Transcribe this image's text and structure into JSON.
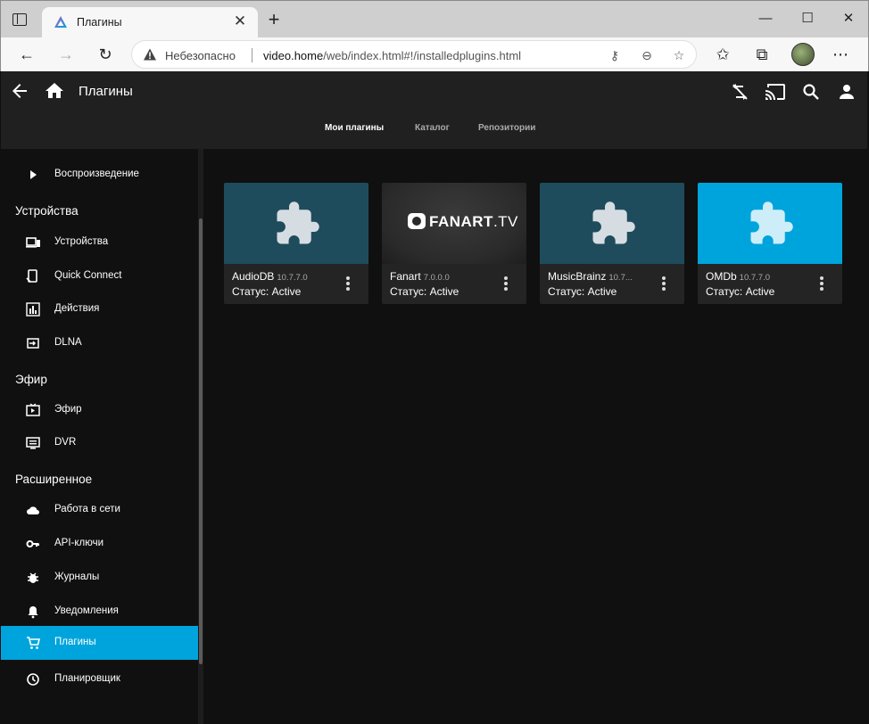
{
  "browser": {
    "tab_title": "Плагины",
    "insecure_label": "Небезопасно",
    "url_host": "video.home",
    "url_path": "/web/index.html#!/installedplugins.html"
  },
  "app": {
    "page_title": "Плагины",
    "tabs": [
      {
        "label": "Мои плагины",
        "active": true
      },
      {
        "label": "Каталог",
        "active": false
      },
      {
        "label": "Репозитории",
        "active": false
      }
    ]
  },
  "sidebar": {
    "playback": "Воспроизведение",
    "devices_header": "Устройства",
    "devices": "Устройства",
    "quick_connect": "Quick Connect",
    "activity": "Действия",
    "dlna": "DLNA",
    "live_header": "Эфир",
    "live": "Эфир",
    "dvr": "DVR",
    "advanced_header": "Расширенное",
    "networking": "Работа в сети",
    "api_keys": "API-ключи",
    "logs": "Журналы",
    "notifications": "Уведомления",
    "plugins": "Плагины",
    "scheduler": "Планировщик",
    "active_color": "#00a4dc"
  },
  "plugins": [
    {
      "name": "AudioDB",
      "version": "10.7.7.0",
      "status": "Статус: Active",
      "bg": "#1f4c5c"
    },
    {
      "name": "Fanart",
      "version": "7.0.0.0",
      "status": "Статус: Active",
      "bg": "#2a2a2a"
    },
    {
      "name": "MusicBrainz",
      "version": "10.7...",
      "status": "Статус: Active",
      "bg": "#1f4c5c"
    },
    {
      "name": "OMDb",
      "version": "10.7.7.0",
      "status": "Статус: Active",
      "bg": "#00a4dc"
    }
  ],
  "fanart_logo": {
    "main": "FANART",
    "suffix": ".TV"
  }
}
